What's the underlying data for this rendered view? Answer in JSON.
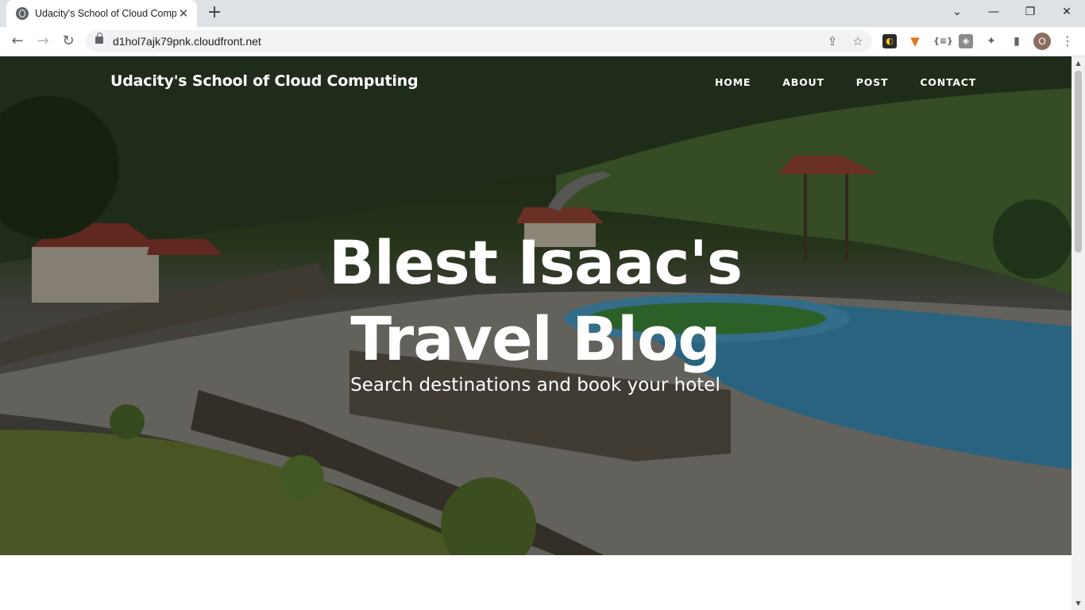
{
  "browser": {
    "tab_title": "Udacity's School of Cloud Computing",
    "tab_close_icon": "close-icon",
    "new_tab_icon": "plus-icon",
    "url": "d1hol7ajk79pnk.cloudfront.net",
    "profile_initial": "O",
    "window_controls": {
      "dropdown": "⌄",
      "minimize": "—",
      "restore": "❐",
      "close": "✕"
    }
  },
  "site": {
    "brand": "Udacity's School of Cloud Computing",
    "nav": [
      "HOME",
      "ABOUT",
      "POST",
      "CONTACT"
    ]
  },
  "hero": {
    "heading_line1": "Blest Isaac's",
    "heading_line2": "Travel Blog",
    "subheading": "Search destinations and book your hotel"
  },
  "colors": {
    "tabstrip": "#dee1e6",
    "omnibox": "#f1f3f4",
    "pool": "#3b8fb8",
    "hero_text": "#ffffff"
  }
}
